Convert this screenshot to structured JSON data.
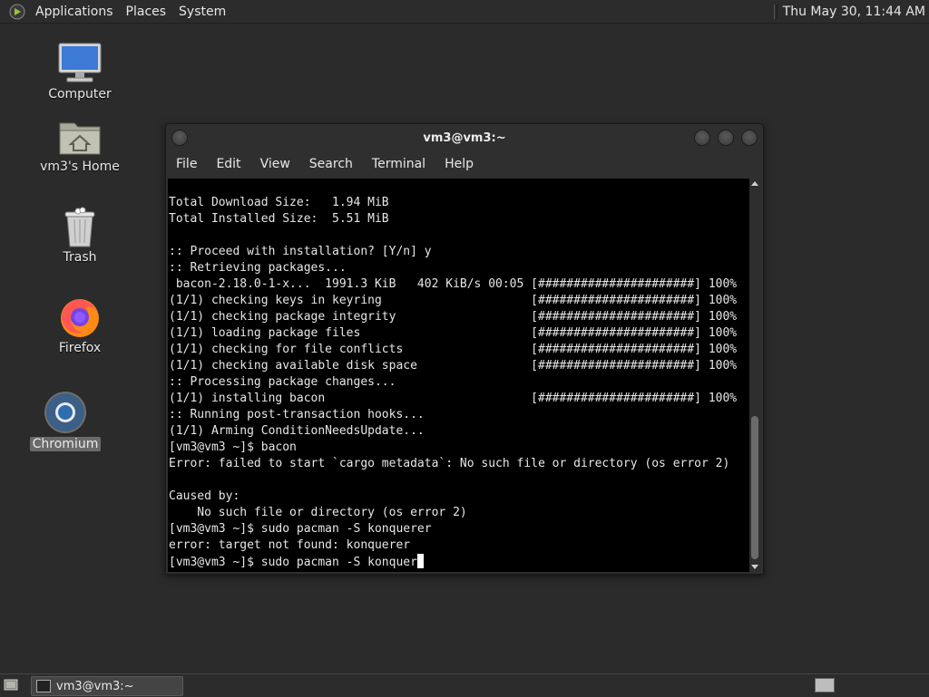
{
  "top_panel": {
    "menus": [
      "Applications",
      "Places",
      "System"
    ],
    "clock": "Thu May 30, 11:44 AM"
  },
  "desktop_icons": [
    {
      "label": "Computer",
      "icon": "computer-icon"
    },
    {
      "label": "vm3's Home",
      "icon": "home-folder-icon"
    },
    {
      "label": "Trash",
      "icon": "trash-icon"
    },
    {
      "label": "Firefox",
      "icon": "firefox-icon"
    },
    {
      "label": "Chromium",
      "icon": "chromium-icon",
      "selected": true
    }
  ],
  "terminal": {
    "title": "vm3@vm3:~",
    "menu": [
      "File",
      "Edit",
      "View",
      "Search",
      "Terminal",
      "Help"
    ],
    "lines": [
      "Total Download Size:   1.94 MiB",
      "Total Installed Size:  5.51 MiB",
      "",
      ":: Proceed with installation? [Y/n] y",
      ":: Retrieving packages...",
      " bacon-2.18.0-1-x...  1991.3 KiB   402 KiB/s 00:05 [######################] 100%",
      "(1/1) checking keys in keyring                     [######################] 100%",
      "(1/1) checking package integrity                   [######################] 100%",
      "(1/1) loading package files                        [######################] 100%",
      "(1/1) checking for file conflicts                  [######################] 100%",
      "(1/1) checking available disk space                [######################] 100%",
      ":: Processing package changes...",
      "(1/1) installing bacon                             [######################] 100%",
      ":: Running post-transaction hooks...",
      "(1/1) Arming ConditionNeedsUpdate...",
      "[vm3@vm3 ~]$ bacon",
      "Error: failed to start `cargo metadata`: No such file or directory (os error 2)",
      "",
      "Caused by:",
      "    No such file or directory (os error 2)",
      "[vm3@vm3 ~]$ sudo pacman -S konquerer",
      "error: target not found: konquerer"
    ],
    "prompt_line": "[vm3@vm3 ~]$ sudo pacman -S konquer"
  },
  "taskbar": {
    "window_button": "vm3@vm3:~"
  }
}
